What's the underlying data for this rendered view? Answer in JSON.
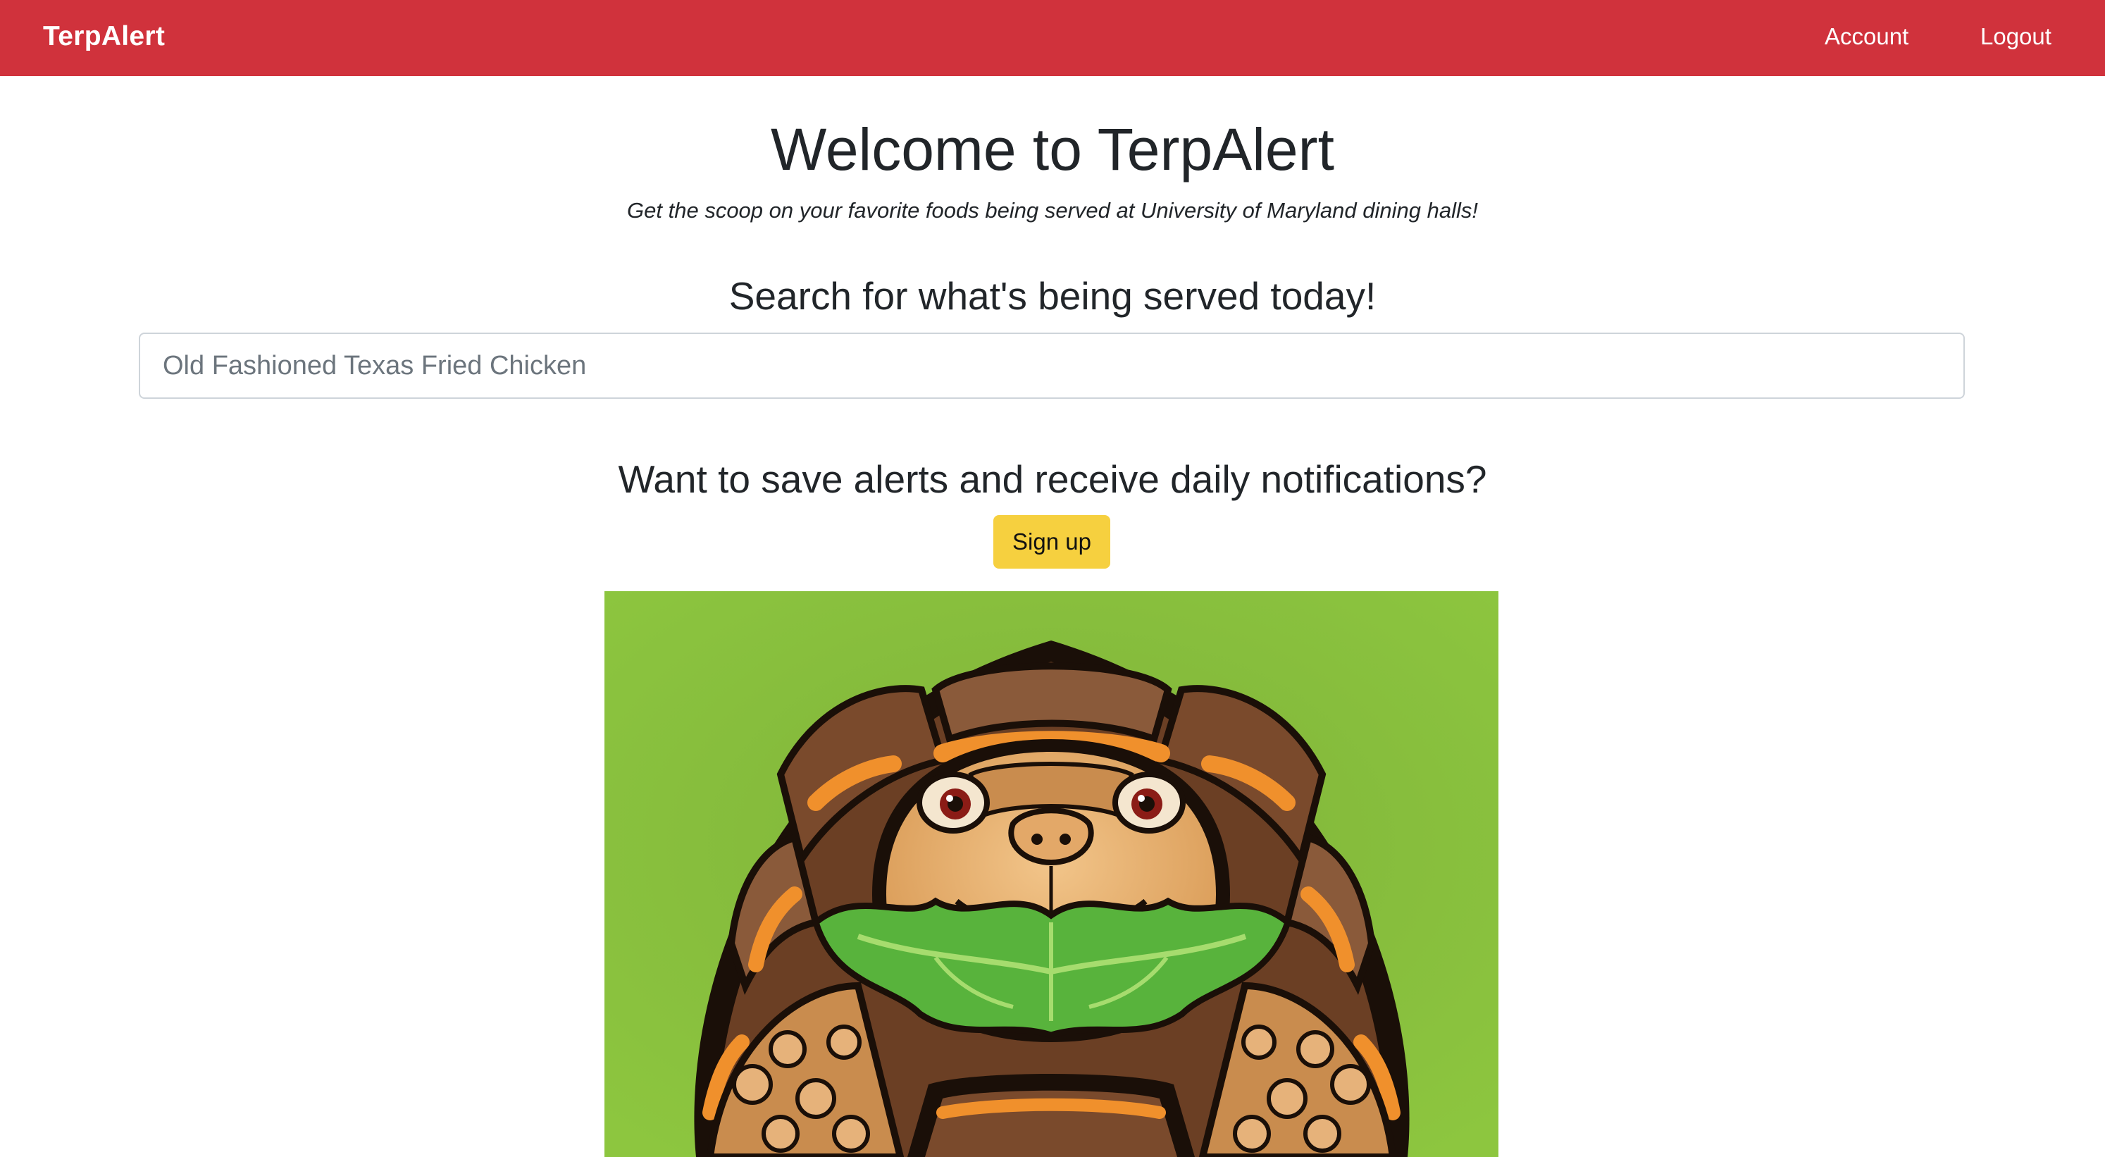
{
  "navbar": {
    "brand": "TerpAlert",
    "links": {
      "account": "Account",
      "logout": "Logout"
    },
    "background_color": "#d0323c"
  },
  "hero": {
    "title": "Welcome to TerpAlert",
    "subtitle": "Get the scoop on your favorite foods being served at University of Maryland dining halls!"
  },
  "search": {
    "heading": "Search for what's being served today!",
    "placeholder": "Old Fashioned Texas Fried Chicken"
  },
  "signup": {
    "heading": "Want to save alerts and receive daily notifications?",
    "button_label": "Sign up",
    "button_color": "#f6d03f"
  },
  "mascot_image": {
    "subject": "terrapin-eating-lettuce-illustration"
  }
}
